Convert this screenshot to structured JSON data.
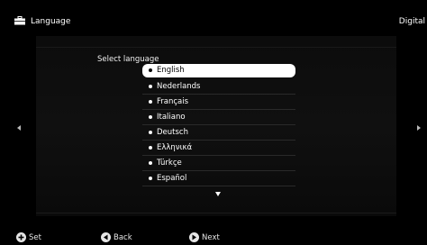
{
  "header": {
    "title": "Language",
    "right_label": "Digital"
  },
  "dialog": {
    "prompt": "Select language",
    "languages": [
      {
        "label": "English",
        "selected": true
      },
      {
        "label": "Nederlands",
        "selected": false
      },
      {
        "label": "Français",
        "selected": false
      },
      {
        "label": "Italiano",
        "selected": false
      },
      {
        "label": "Deutsch",
        "selected": false
      },
      {
        "label": "Ελληνικά",
        "selected": false
      },
      {
        "label": "Türkçe",
        "selected": false
      },
      {
        "label": "Español",
        "selected": false
      }
    ]
  },
  "footer": {
    "set_label": "Set",
    "back_label": "Back",
    "next_label": "Next"
  },
  "icons": {
    "header": "toolbox-icon",
    "set": "plus-circle-icon",
    "back": "left-arrow-circle-icon",
    "next": "right-arrow-circle-icon",
    "left": "left-arrow-icon",
    "right": "right-arrow-icon",
    "more": "down-arrow-icon"
  },
  "colors": {
    "background": "#000000",
    "selected_bg": "#ffffff",
    "text": "#ffffff"
  }
}
